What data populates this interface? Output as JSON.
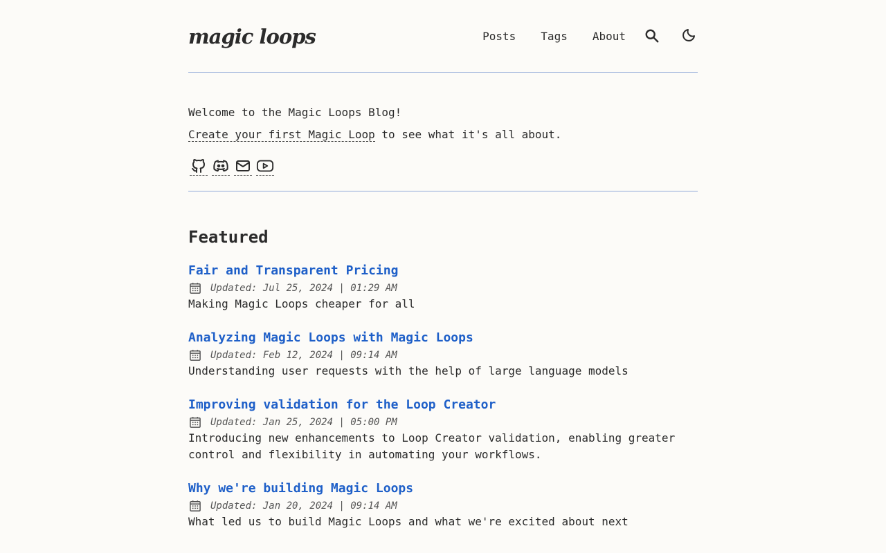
{
  "header": {
    "logo_text": "magic loops",
    "nav": {
      "posts": "Posts",
      "tags": "Tags",
      "about": "About"
    },
    "icons": [
      "search-icon",
      "moon-icon"
    ]
  },
  "intro": {
    "welcome": "Welcome to the Magic Loops Blog!",
    "link_text": "Create your first Magic Loop",
    "link_suffix": " to see what it's all about.",
    "socials": [
      "github-icon",
      "discord-icon",
      "mail-icon",
      "youtube-icon"
    ]
  },
  "featured": {
    "heading": "Featured",
    "posts": [
      {
        "title": "Fair and Transparent Pricing",
        "date": "Updated: Jul 25, 2024 | 01:29 AM",
        "description": "Making Magic Loops cheaper for all"
      },
      {
        "title": "Analyzing Magic Loops with Magic Loops",
        "date": "Updated: Feb 12, 2024 | 09:14 AM",
        "description": "Understanding user requests with the help of large language models"
      },
      {
        "title": "Improving validation for the Loop Creator",
        "date": "Updated: Jan 25, 2024 | 05:00 PM",
        "description": "Introducing new enhancements to Loop Creator validation, enabling greater control and flexibility in automating your workflows."
      },
      {
        "title": "Why we're building Magic Loops",
        "date": "Updated: Jan 20, 2024 | 09:14 AM",
        "description": "What led us to build Magic Loops and what we're excited about next"
      }
    ]
  },
  "colors": {
    "background": "#fcfbf8",
    "text": "#2b2b2b",
    "accent": "#1e5fc8",
    "divider": "#8fa8d8"
  }
}
